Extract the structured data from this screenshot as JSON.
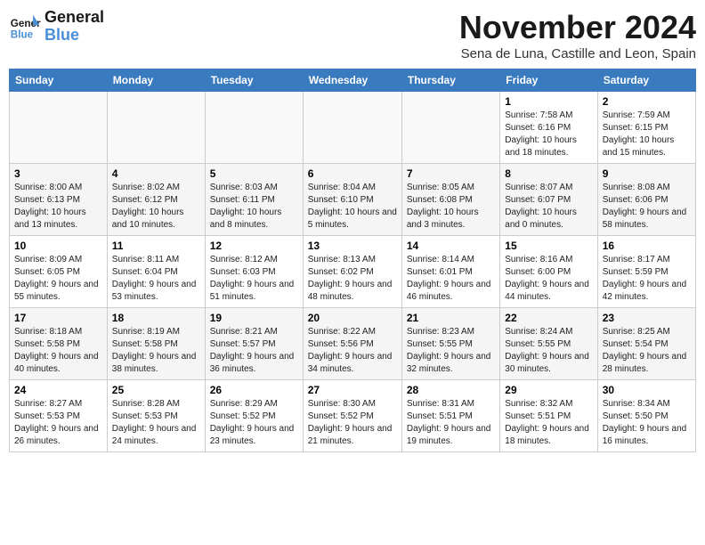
{
  "header": {
    "logo_line1": "General",
    "logo_line2": "Blue",
    "month": "November 2024",
    "location": "Sena de Luna, Castille and Leon, Spain"
  },
  "weekdays": [
    "Sunday",
    "Monday",
    "Tuesday",
    "Wednesday",
    "Thursday",
    "Friday",
    "Saturday"
  ],
  "weeks": [
    [
      {
        "day": "",
        "info": ""
      },
      {
        "day": "",
        "info": ""
      },
      {
        "day": "",
        "info": ""
      },
      {
        "day": "",
        "info": ""
      },
      {
        "day": "",
        "info": ""
      },
      {
        "day": "1",
        "info": "Sunrise: 7:58 AM\nSunset: 6:16 PM\nDaylight: 10 hours and 18 minutes."
      },
      {
        "day": "2",
        "info": "Sunrise: 7:59 AM\nSunset: 6:15 PM\nDaylight: 10 hours and 15 minutes."
      }
    ],
    [
      {
        "day": "3",
        "info": "Sunrise: 8:00 AM\nSunset: 6:13 PM\nDaylight: 10 hours and 13 minutes."
      },
      {
        "day": "4",
        "info": "Sunrise: 8:02 AM\nSunset: 6:12 PM\nDaylight: 10 hours and 10 minutes."
      },
      {
        "day": "5",
        "info": "Sunrise: 8:03 AM\nSunset: 6:11 PM\nDaylight: 10 hours and 8 minutes."
      },
      {
        "day": "6",
        "info": "Sunrise: 8:04 AM\nSunset: 6:10 PM\nDaylight: 10 hours and 5 minutes."
      },
      {
        "day": "7",
        "info": "Sunrise: 8:05 AM\nSunset: 6:08 PM\nDaylight: 10 hours and 3 minutes."
      },
      {
        "day": "8",
        "info": "Sunrise: 8:07 AM\nSunset: 6:07 PM\nDaylight: 10 hours and 0 minutes."
      },
      {
        "day": "9",
        "info": "Sunrise: 8:08 AM\nSunset: 6:06 PM\nDaylight: 9 hours and 58 minutes."
      }
    ],
    [
      {
        "day": "10",
        "info": "Sunrise: 8:09 AM\nSunset: 6:05 PM\nDaylight: 9 hours and 55 minutes."
      },
      {
        "day": "11",
        "info": "Sunrise: 8:11 AM\nSunset: 6:04 PM\nDaylight: 9 hours and 53 minutes."
      },
      {
        "day": "12",
        "info": "Sunrise: 8:12 AM\nSunset: 6:03 PM\nDaylight: 9 hours and 51 minutes."
      },
      {
        "day": "13",
        "info": "Sunrise: 8:13 AM\nSunset: 6:02 PM\nDaylight: 9 hours and 48 minutes."
      },
      {
        "day": "14",
        "info": "Sunrise: 8:14 AM\nSunset: 6:01 PM\nDaylight: 9 hours and 46 minutes."
      },
      {
        "day": "15",
        "info": "Sunrise: 8:16 AM\nSunset: 6:00 PM\nDaylight: 9 hours and 44 minutes."
      },
      {
        "day": "16",
        "info": "Sunrise: 8:17 AM\nSunset: 5:59 PM\nDaylight: 9 hours and 42 minutes."
      }
    ],
    [
      {
        "day": "17",
        "info": "Sunrise: 8:18 AM\nSunset: 5:58 PM\nDaylight: 9 hours and 40 minutes."
      },
      {
        "day": "18",
        "info": "Sunrise: 8:19 AM\nSunset: 5:58 PM\nDaylight: 9 hours and 38 minutes."
      },
      {
        "day": "19",
        "info": "Sunrise: 8:21 AM\nSunset: 5:57 PM\nDaylight: 9 hours and 36 minutes."
      },
      {
        "day": "20",
        "info": "Sunrise: 8:22 AM\nSunset: 5:56 PM\nDaylight: 9 hours and 34 minutes."
      },
      {
        "day": "21",
        "info": "Sunrise: 8:23 AM\nSunset: 5:55 PM\nDaylight: 9 hours and 32 minutes."
      },
      {
        "day": "22",
        "info": "Sunrise: 8:24 AM\nSunset: 5:55 PM\nDaylight: 9 hours and 30 minutes."
      },
      {
        "day": "23",
        "info": "Sunrise: 8:25 AM\nSunset: 5:54 PM\nDaylight: 9 hours and 28 minutes."
      }
    ],
    [
      {
        "day": "24",
        "info": "Sunrise: 8:27 AM\nSunset: 5:53 PM\nDaylight: 9 hours and 26 minutes."
      },
      {
        "day": "25",
        "info": "Sunrise: 8:28 AM\nSunset: 5:53 PM\nDaylight: 9 hours and 24 minutes."
      },
      {
        "day": "26",
        "info": "Sunrise: 8:29 AM\nSunset: 5:52 PM\nDaylight: 9 hours and 23 minutes."
      },
      {
        "day": "27",
        "info": "Sunrise: 8:30 AM\nSunset: 5:52 PM\nDaylight: 9 hours and 21 minutes."
      },
      {
        "day": "28",
        "info": "Sunrise: 8:31 AM\nSunset: 5:51 PM\nDaylight: 9 hours and 19 minutes."
      },
      {
        "day": "29",
        "info": "Sunrise: 8:32 AM\nSunset: 5:51 PM\nDaylight: 9 hours and 18 minutes."
      },
      {
        "day": "30",
        "info": "Sunrise: 8:34 AM\nSunset: 5:50 PM\nDaylight: 9 hours and 16 minutes."
      }
    ]
  ]
}
